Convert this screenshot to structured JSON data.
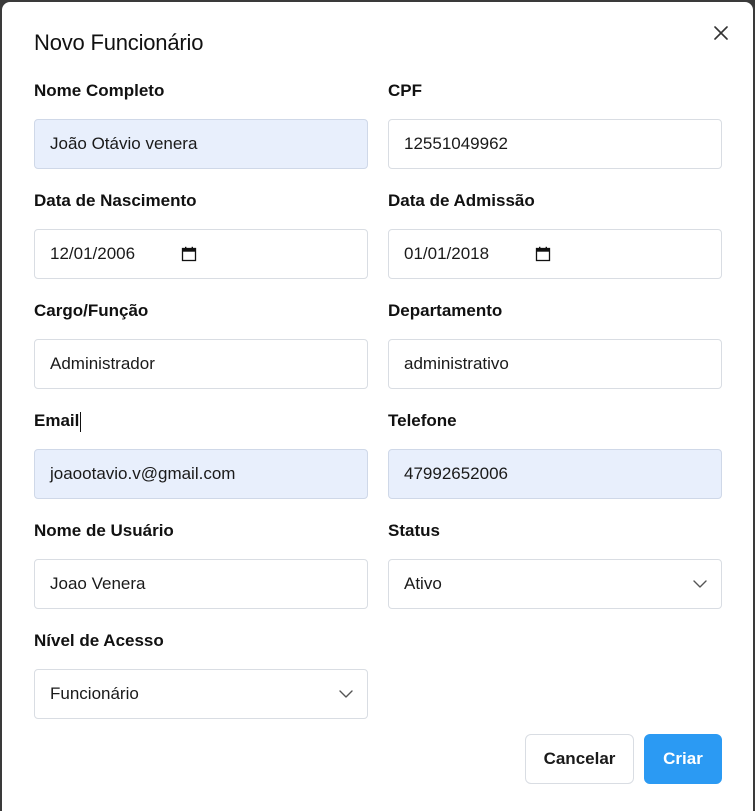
{
  "dialog": {
    "title": "Novo Funcionário",
    "close_icon": "close-icon"
  },
  "fields": {
    "nome_completo": {
      "label": "Nome Completo",
      "value": "João Otávio venera"
    },
    "cpf": {
      "label": "CPF",
      "value": "12551049962"
    },
    "data_nascimento": {
      "label": "Data de Nascimento",
      "value": "12/01/2006",
      "icon": "calendar-icon"
    },
    "data_admissao": {
      "label": "Data de Admissão",
      "value": "01/01/2018",
      "icon": "calendar-icon"
    },
    "cargo": {
      "label": "Cargo/Função",
      "value": "Administrador"
    },
    "departamento": {
      "label": "Departamento",
      "value": "administrativo"
    },
    "email": {
      "label": "Email",
      "value": "joaootavio.v@gmail.com"
    },
    "telefone": {
      "label": "Telefone",
      "value": "47992652006"
    },
    "usuario": {
      "label": "Nome de Usuário",
      "value": "Joao Venera"
    },
    "status": {
      "label": "Status",
      "value": "Ativo",
      "icon": "chevron-down-icon"
    },
    "nivel_acesso": {
      "label": "Nível de Acesso",
      "value": "Funcionário",
      "icon": "chevron-down-icon"
    }
  },
  "actions": {
    "cancel_label": "Cancelar",
    "create_label": "Criar"
  },
  "colors": {
    "primary": "#2b9af3",
    "autofill_background": "#e8effc",
    "border": "#d9dde3"
  }
}
